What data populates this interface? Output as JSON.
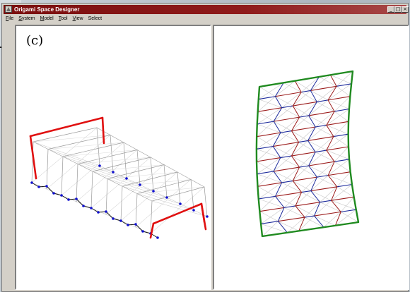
{
  "window": {
    "title": "Origami Space Designer"
  },
  "window_controls": {
    "minimize": "_",
    "maximize": "□",
    "close": "×"
  },
  "menu": {
    "items": [
      {
        "mnemonic": "F",
        "rest": "ile"
      },
      {
        "mnemonic": "S",
        "rest": "ystem"
      },
      {
        "mnemonic": "M",
        "rest": "odel"
      },
      {
        "mnemonic": "T",
        "rest": "ool"
      },
      {
        "mnemonic": "V",
        "rest": "iew"
      },
      {
        "mnemonic": "",
        "rest": "Select"
      }
    ]
  },
  "panels": {
    "left_label": "(c)"
  },
  "slide": {
    "paren": "("
  },
  "colors": {
    "boundary": "#1f8a1f",
    "mountain": "#9b1c1c",
    "valley": "#1c2a9b",
    "highlight": "#e01010",
    "vertex": "#1010d0",
    "mesh": "#9a9a9a",
    "title_bar": "#7a0e0e"
  }
}
